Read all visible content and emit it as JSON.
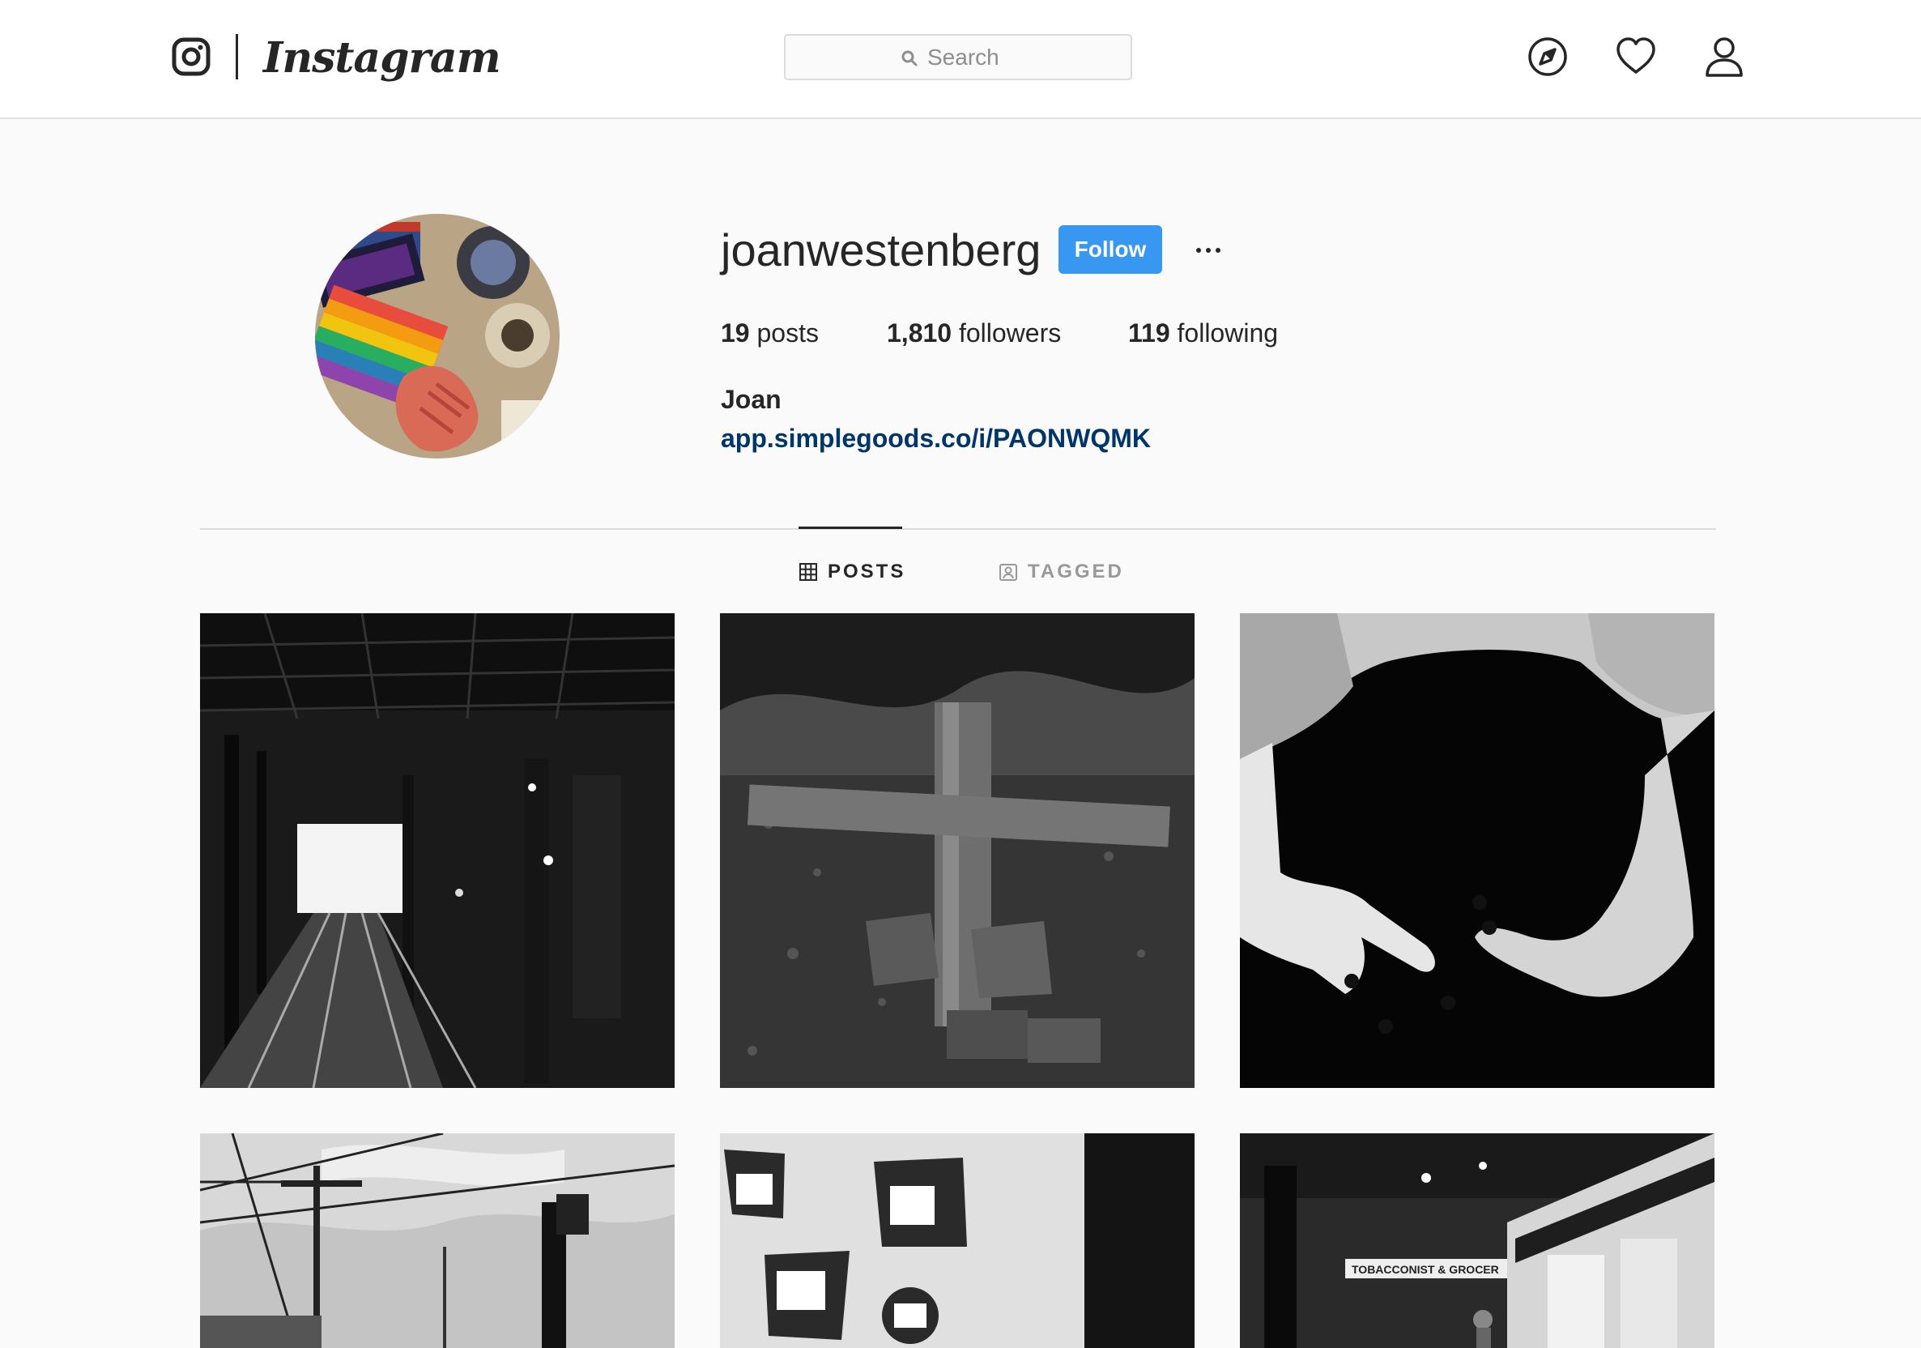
{
  "header": {
    "brand": "Instagram",
    "search_placeholder": "Search",
    "icons": [
      "instagram-camera-icon",
      "search-icon",
      "compass-icon",
      "heart-icon",
      "user-icon"
    ]
  },
  "profile": {
    "username": "joanwestenberg",
    "follow_label": "Follow",
    "more_label": "...",
    "stats": {
      "posts_count": "19",
      "posts_label": "posts",
      "followers_count": "1,810",
      "followers_label": "followers",
      "following_count": "119",
      "following_label": "following"
    },
    "full_name": "Joan",
    "link": "app.simplegoods.co/i/PAONWQMK"
  },
  "tabs": [
    {
      "label": "POSTS",
      "icon": "grid-icon",
      "active": true
    },
    {
      "label": "TAGGED",
      "icon": "tag-person-icon",
      "active": false
    }
  ],
  "posts": [
    {
      "subject": "railway tunnel"
    },
    {
      "subject": "wooden cross"
    },
    {
      "subject": "hands"
    },
    {
      "subject": "overhead wires and signal"
    },
    {
      "subject": "framed photos on wall"
    },
    {
      "subject": "storefront"
    }
  ],
  "signs": {
    "tobacconist": "TOBACCONIST & GROCER"
  },
  "colors": {
    "accent": "#3897f0",
    "link": "#003569",
    "text": "#262626",
    "muted": "#8e8e8e",
    "background": "#fafafa"
  }
}
